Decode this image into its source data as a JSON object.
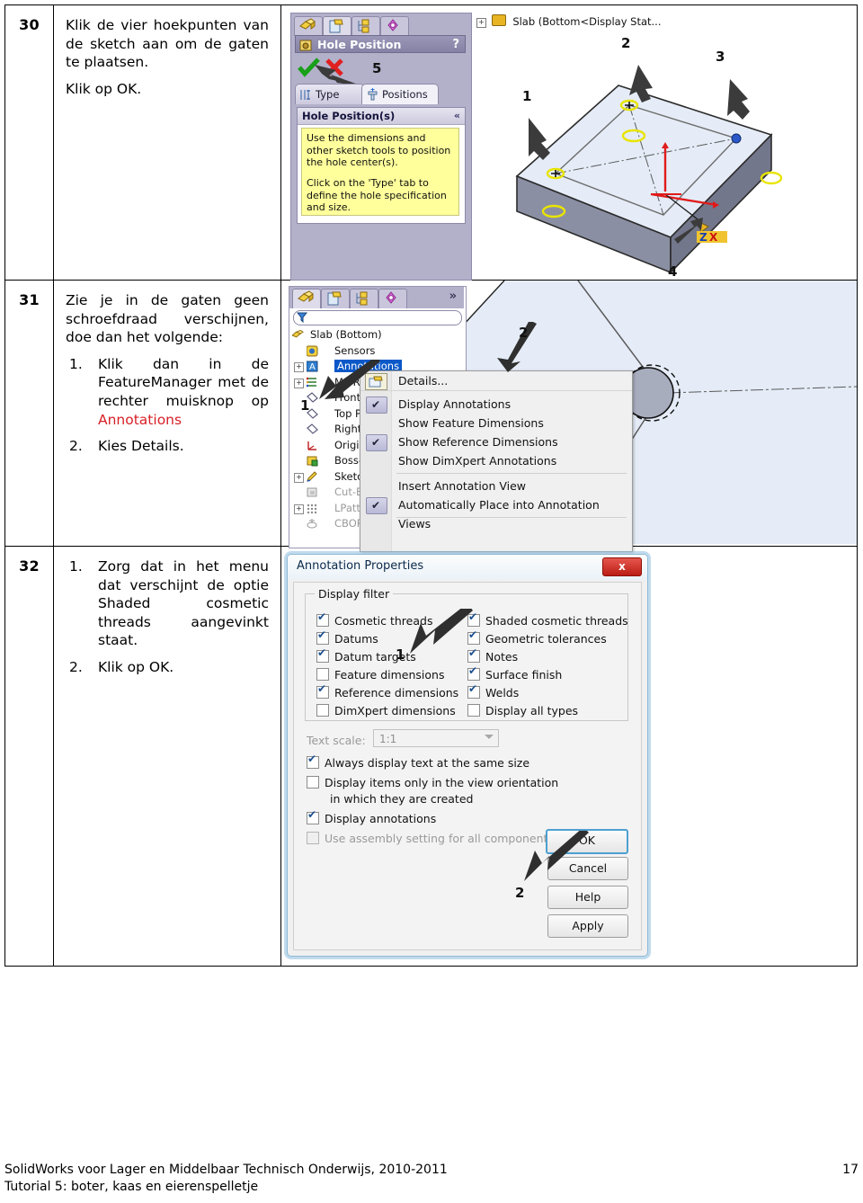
{
  "rows": [
    {
      "number": "30",
      "paragraphs": [
        "Klik de vier hoekpunten van de sketch aan om de gaten te plaatsen.",
        "Klik op OK."
      ],
      "panel": {
        "kind": "property-manager",
        "title": "Hole Position",
        "help_glyph": "?",
        "tabs": [
          "Type",
          "Positions"
        ],
        "selected_tab": "Positions",
        "group_title": "Hole Position(s)",
        "group_collapse_glyph": "«",
        "message": [
          "Use the dimensions and other sketch tools to position the hole center(s).",
          "Click on the 'Type' tab to define the hole specification and size."
        ],
        "callout": "5"
      },
      "graphics": {
        "tree_header": "Slab  (Bottom<Display Stat...",
        "callouts": [
          "1",
          "2",
          "3",
          "4"
        ]
      }
    },
    {
      "number": "31",
      "intro": "Zie je in de gaten geen schroefdraad verschijnen, doe dan het volgende:",
      "steps": [
        {
          "marker": "1.",
          "text_before": "Klik dan in de FeatureManager met de rechter muisknop op ",
          "highlight": "Annotations",
          "text_after": ""
        },
        {
          "marker": "2.",
          "text_before": "Kies Details.",
          "highlight": "",
          "text_after": ""
        }
      ],
      "tree": {
        "filter_placeholder": "",
        "overflow_glyph": "»",
        "items": [
          {
            "label": "Slab  (Bottom)",
            "indent": 0,
            "expand": false,
            "state": "normal"
          },
          {
            "label": "Sensors",
            "indent": 1,
            "expand": false,
            "state": "normal"
          },
          {
            "label": "Annotations",
            "indent": 1,
            "expand": true,
            "state": "selected"
          },
          {
            "label": "Ma  Ri",
            "indent": 1,
            "expand": true,
            "state": "normal"
          },
          {
            "label": "Front P",
            "indent": 1,
            "expand": false,
            "state": "normal"
          },
          {
            "label": "Top Pla",
            "indent": 1,
            "expand": false,
            "state": "normal"
          },
          {
            "label": "Right P",
            "indent": 1,
            "expand": false,
            "state": "normal"
          },
          {
            "label": "Origin",
            "indent": 1,
            "expand": false,
            "state": "normal"
          },
          {
            "label": "Boss-E",
            "indent": 1,
            "expand": false,
            "state": "normal"
          },
          {
            "label": "Sketch.",
            "indent": 1,
            "expand": true,
            "state": "normal"
          },
          {
            "label": "Cut-Ex",
            "indent": 1,
            "expand": false,
            "state": "dim"
          },
          {
            "label": "LPatter",
            "indent": 1,
            "expand": true,
            "state": "dim"
          },
          {
            "label": "CBORE",
            "indent": 1,
            "expand": false,
            "state": "dim"
          }
        ]
      },
      "context_menu": {
        "items": [
          {
            "label": "Details...",
            "checked": false,
            "icon": true
          },
          {
            "label": "Display Annotations",
            "checked": true,
            "icon": false
          },
          {
            "label": "Show Feature Dimensions",
            "checked": false,
            "icon": false
          },
          {
            "label": "Show Reference Dimensions",
            "checked": true,
            "icon": false
          },
          {
            "label": "Show DimXpert Annotations",
            "checked": false,
            "icon": false
          },
          {
            "label": "Insert Annotation View",
            "checked": false,
            "icon": false
          },
          {
            "label": "Automatically Place into Annotation Views",
            "checked": true,
            "icon": false
          }
        ]
      },
      "callouts": [
        "1",
        "2"
      ]
    },
    {
      "number": "32",
      "steps": [
        {
          "marker": "1.",
          "text": "Zorg dat in het menu dat verschijnt de optie Shaded cosmetic threads aangevinkt staat."
        },
        {
          "marker": "2.",
          "text": "Klik op OK."
        }
      ],
      "dialog": {
        "title": "Annotation Properties",
        "close_label": "x",
        "fieldset_legend": "Display filter",
        "checkboxes_left": [
          {
            "label": "Cosmetic threads",
            "checked": true,
            "disabled": false
          },
          {
            "label": "Datums",
            "checked": true,
            "disabled": false
          },
          {
            "label": "Datum targets",
            "checked": true,
            "disabled": false
          },
          {
            "label": "Feature dimensions",
            "checked": false,
            "disabled": false
          },
          {
            "label": "Reference dimensions",
            "checked": true,
            "disabled": false
          },
          {
            "label": "DimXpert dimensions",
            "checked": false,
            "disabled": false
          }
        ],
        "checkboxes_right": [
          {
            "label": "Shaded cosmetic threads",
            "checked": true,
            "disabled": false
          },
          {
            "label": "Geometric tolerances",
            "checked": true,
            "disabled": false
          },
          {
            "label": "Notes",
            "checked": true,
            "disabled": false
          },
          {
            "label": "Surface finish",
            "checked": true,
            "disabled": false
          },
          {
            "label": "Welds",
            "checked": true,
            "disabled": false
          },
          {
            "label": "Display all types",
            "checked": false,
            "disabled": false
          }
        ],
        "text_scale_label": "Text scale:",
        "text_scale_value": "1:1",
        "options": [
          {
            "label": "Always display text at the same size",
            "checked": true,
            "disabled": false
          },
          {
            "label": "Display items only in the view orientation",
            "label2": "in which they are created",
            "checked": false,
            "disabled": false
          },
          {
            "label": "Display annotations",
            "checked": true,
            "disabled": false
          },
          {
            "label": "Use assembly setting for all components",
            "checked": false,
            "disabled": true
          }
        ],
        "buttons": [
          "OK",
          "Cancel",
          "Help",
          "Apply"
        ],
        "callouts": [
          "1",
          "2"
        ]
      }
    }
  ],
  "footer": {
    "line1": "SolidWorks voor Lager en Middelbaar Technisch Onderwijs, 2010-2011",
    "line2": "Tutorial 5: boter, kaas en eierenspelletje",
    "page_number": "17"
  },
  "colors": {
    "highlight_red": "#d81f26",
    "selection_blue": "#0a58c8",
    "panel_purple": "#b3b0ca",
    "tooltip_yellow": "#ffff9c"
  }
}
